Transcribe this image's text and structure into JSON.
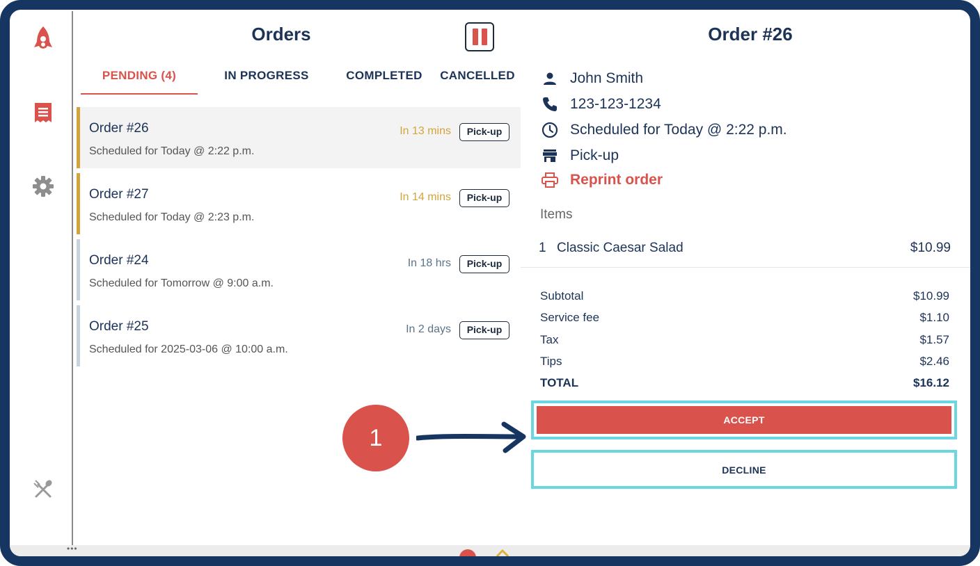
{
  "sidebar": {
    "items": [
      {
        "name": "app-logo",
        "icon": "rocket-logo-icon"
      },
      {
        "name": "orders",
        "icon": "receipt-icon"
      },
      {
        "name": "settings",
        "icon": "gear-icon"
      },
      {
        "name": "menu",
        "icon": "utensils-icon"
      }
    ]
  },
  "orders_panel": {
    "title": "Orders",
    "pause_icon": "pause-icon",
    "tabs": [
      {
        "label": "PENDING (4)",
        "active": true
      },
      {
        "label": "IN PROGRESS",
        "active": false
      },
      {
        "label": "COMPLETED",
        "active": false
      },
      {
        "label": "CANCELLED",
        "active": false
      }
    ],
    "orders": [
      {
        "title": "Order #26",
        "scheduled": "Scheduled for Today @ 2:22 p.m.",
        "eta": "In 13 mins",
        "type": "Pick-up",
        "selected": true
      },
      {
        "title": "Order #27",
        "scheduled": "Scheduled for Today @ 2:23 p.m.",
        "eta": "In 14 mins",
        "type": "Pick-up",
        "selected": false
      },
      {
        "title": "Order #24",
        "scheduled": "Scheduled for Tomorrow @ 9:00 a.m.",
        "eta": "In 18 hrs",
        "type": "Pick-up",
        "selected": false
      },
      {
        "title": "Order #25",
        "scheduled": "Scheduled for 2025-03-06 @ 10:00 a.m.",
        "eta": "In 2 days",
        "type": "Pick-up",
        "selected": false
      }
    ]
  },
  "detail": {
    "title": "Order #26",
    "customer_name": "John Smith",
    "phone": "123-123-1234",
    "schedule": "Scheduled for Today @ 2:22 p.m.",
    "fulfillment": "Pick-up",
    "reprint_label": "Reprint order",
    "items_label": "Items",
    "items": [
      {
        "qty": "1",
        "name": "Classic Caesar Salad",
        "price": "$10.99"
      }
    ],
    "totals": [
      {
        "label": "Subtotal",
        "value": "$10.99"
      },
      {
        "label": "Service fee",
        "value": "$1.10"
      },
      {
        "label": "Tax",
        "value": "$1.57"
      },
      {
        "label": "Tips",
        "value": "$2.46"
      },
      {
        "label": "TOTAL",
        "value": "$16.12"
      }
    ],
    "accept_label": "ACCEPT",
    "decline_label": "DECLINE"
  },
  "annotation": {
    "step": "1"
  },
  "colors": {
    "frame": "#163560",
    "accent_red": "#d9534c",
    "text_navy": "#1c3358",
    "pending_soon": "#d4a43c",
    "pending_later": "#c6d4de",
    "eta_later": "#5a7488",
    "highlight": "#6ad6e2"
  }
}
